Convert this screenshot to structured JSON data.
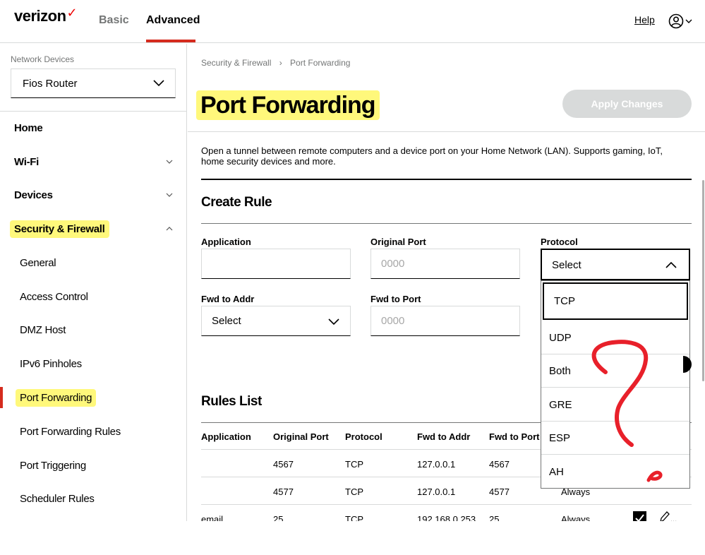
{
  "header": {
    "logo": "verizon",
    "logo_check": "✓",
    "tabs": [
      {
        "label": "Basic"
      },
      {
        "label": "Advanced"
      }
    ],
    "help_label": "Help",
    "icons": {
      "user": "user-circle-icon",
      "chevron": "chevron-down-icon"
    }
  },
  "sidebar": {
    "section_label": "Network Devices",
    "device_selected": "Fios Router",
    "items": {
      "home": "Home",
      "wifi": "Wi-Fi",
      "devices": "Devices",
      "security": "Security & Firewall"
    },
    "sub_items": {
      "general": "General",
      "access_control": "Access Control",
      "dmz": "DMZ Host",
      "ipv6": "IPv6 Pinholes",
      "port_forwarding": "Port Forwarding",
      "port_forwarding_rules": "Port Forwarding Rules",
      "port_triggering": "Port Triggering",
      "scheduler": "Scheduler Rules"
    },
    "active_color": "#d52b1e"
  },
  "breadcrumb": {
    "parent": "Security & Firewall",
    "current": "Port Forwarding"
  },
  "page": {
    "title": "Port Forwarding",
    "apply_label": "Apply Changes",
    "description": "Open a tunnel between remote computers and a device port on your Home Network (LAN). Supports gaming, IoT, home security devices and more."
  },
  "create_rule": {
    "title": "Create Rule",
    "application_label": "Application",
    "application_value": "",
    "original_port_label": "Original Port",
    "original_port_placeholder": "0000",
    "protocol_label": "Protocol",
    "protocol_selected": "Select",
    "protocol_options": [
      "TCP",
      "UDP",
      "Both",
      "GRE",
      "ESP",
      "AH"
    ],
    "fwd_addr_label": "Fwd to Addr",
    "fwd_addr_selected": "Select",
    "fwd_port_label": "Fwd to Port",
    "fwd_port_placeholder": "0000"
  },
  "rules_list": {
    "title": "Rules List",
    "columns": {
      "application": "Application",
      "original_port": "Original Port",
      "protocol": "Protocol",
      "fwd_addr": "Fwd to Addr",
      "fwd_port": "Fwd to Port"
    },
    "rows": [
      {
        "application": "",
        "original_port": "4567",
        "protocol": "TCP",
        "fwd_addr": "127.0.0.1",
        "fwd_port": "4567",
        "schedule": ""
      },
      {
        "application": "",
        "original_port": "4577",
        "protocol": "TCP",
        "fwd_addr": "127.0.0.1",
        "fwd_port": "4577",
        "schedule": "Always"
      },
      {
        "application": "email",
        "original_port": "25",
        "protocol": "TCP",
        "fwd_addr": "192.168.0.253",
        "fwd_port": "25",
        "schedule": "Always"
      }
    ],
    "row_ellipsis": "..."
  },
  "colors": {
    "accent": "#d52b1e",
    "highlight": "#fff764",
    "annotation": "#e8202a",
    "disabled": "#d8dada"
  }
}
